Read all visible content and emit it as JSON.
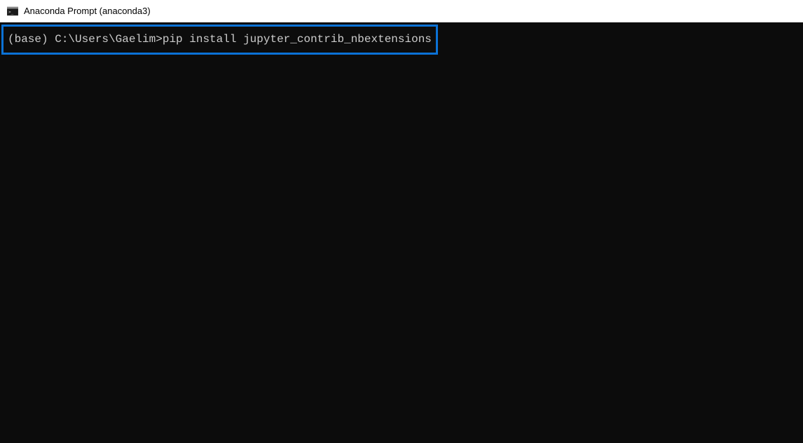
{
  "window": {
    "title": "Anaconda Prompt (anaconda3)"
  },
  "terminal": {
    "prompt": "(base) C:\\Users\\Gaelim>",
    "command": "pip install jupyter_contrib_nbextensions"
  },
  "colors": {
    "highlight": "#0b72d6",
    "terminal_bg": "#0c0c0c",
    "terminal_fg": "#cccccc"
  }
}
